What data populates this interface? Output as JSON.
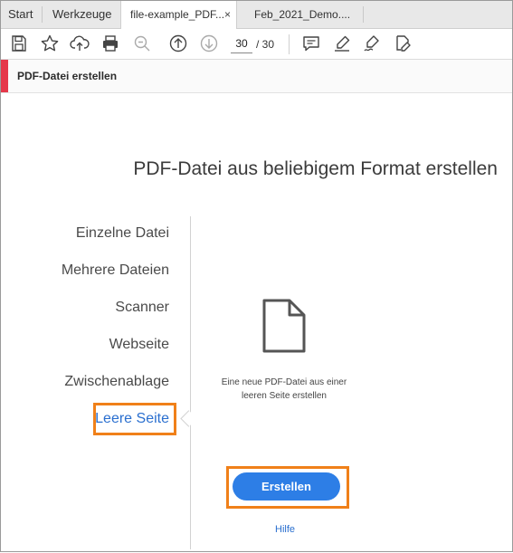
{
  "tabs": [
    {
      "label": "Start"
    },
    {
      "label": "Werkzeuge"
    },
    {
      "label": "file-example_PDF...",
      "close": "×"
    },
    {
      "label": "Feb_2021_Demo...."
    }
  ],
  "toolbar": {
    "icons": [
      "save-icon",
      "bookmark-star-icon",
      "upload-cloud-icon",
      "print-icon",
      "zoom-out-icon",
      "page-up-icon",
      "page-down-icon",
      "comment-icon",
      "highlight-pen-icon",
      "sign-icon",
      "edit-document-icon"
    ],
    "page_current": "30",
    "page_total": "/ 30"
  },
  "tool_header": {
    "title": "PDF-Datei erstellen",
    "accent_color": "#e5384a"
  },
  "main": {
    "heading": "PDF-Datei aus beliebigem Format erstellen",
    "options": [
      {
        "label": "Einzelne Datei"
      },
      {
        "label": "Mehrere Dateien"
      },
      {
        "label": "Scanner"
      },
      {
        "label": "Webseite"
      },
      {
        "label": "Zwischenablage"
      },
      {
        "label": "Leere Seite",
        "selected": true
      }
    ],
    "description_line1": "Eine neue PDF-Datei aus einer",
    "description_line2": "leeren Seite erstellen",
    "create_button": "Erstellen",
    "help_link": "Hilfe"
  },
  "colors": {
    "accent_blue": "#2d7ee6",
    "highlight_orange": "#f08019"
  }
}
